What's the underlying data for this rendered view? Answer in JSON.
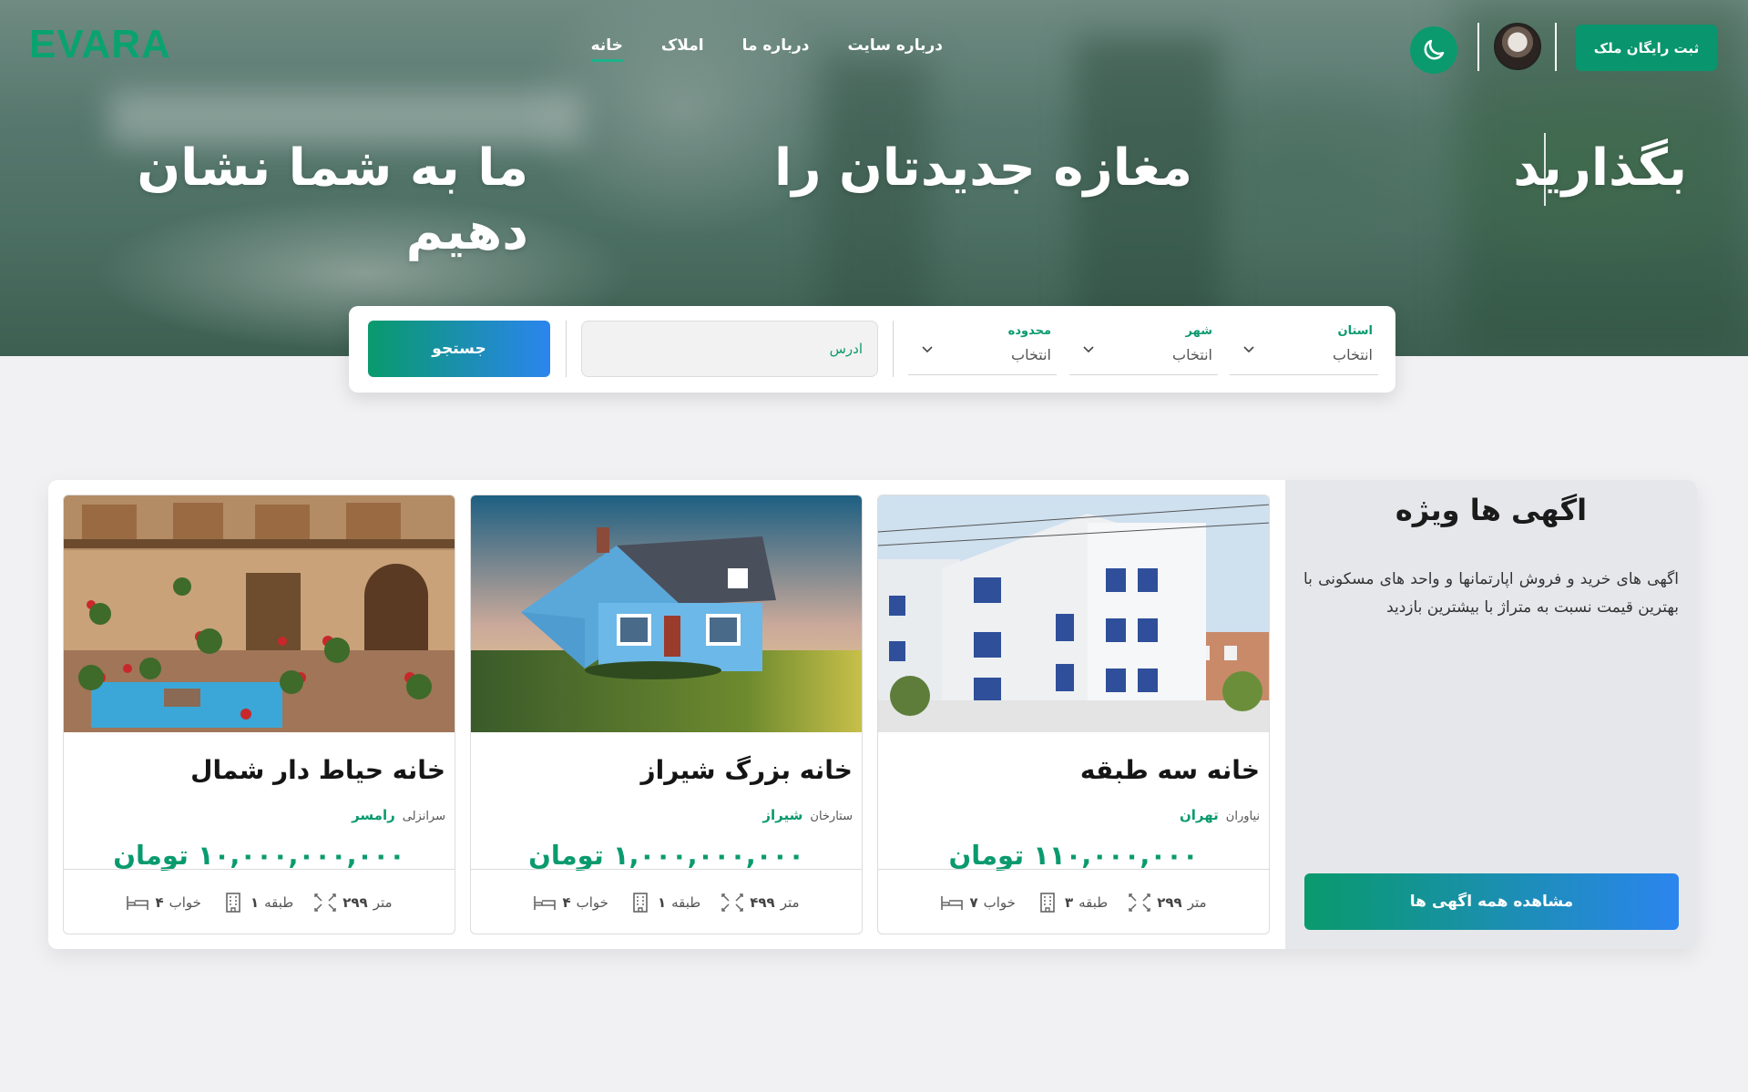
{
  "header": {
    "logo": "EVARA",
    "nav": [
      {
        "label": "خانه",
        "active": true
      },
      {
        "label": "املاک",
        "active": false
      },
      {
        "label": "درباره ما",
        "active": false
      },
      {
        "label": "درباره سایت",
        "active": false
      }
    ],
    "register_button": "ثبت رایگان ملک",
    "theme_icon": "moon-icon",
    "accent_color": "#09956d"
  },
  "hero": {
    "text_right": "بگذارید",
    "text_middle": "مغازه جدیدتان را",
    "text_left": "ما به شما نشان دهیم"
  },
  "search": {
    "province": {
      "label": "استان",
      "value": "انتخاب"
    },
    "city": {
      "label": "شهر",
      "value": "انتخاب"
    },
    "district": {
      "label": "محدوده",
      "value": "انتخاب"
    },
    "address_placeholder": "ادرس",
    "button": "جستجو"
  },
  "featured": {
    "title": "اگهی ها ویژه",
    "description": "اگهی های خرید و فروش اپارتمانها و واحد های مسکونی با بهترین قیمت نسبت به متراژ با بیشترین بازدید",
    "button": "مشاهده همه اگهی ها",
    "listings": [
      {
        "title": "خانه سه طبقه",
        "city": "تهران",
        "area": "نیاوران",
        "price": "۱۱۰,۰۰۰,۰۰۰ تومان",
        "bedrooms": "۷",
        "bedrooms_label": "خواب",
        "floors": "۳",
        "floors_label": "طبقه",
        "size": "۲۹۹",
        "size_label": "متر"
      },
      {
        "title": "خانه بزرگ شیراز",
        "city": "شیراز",
        "area": "ستارخان",
        "price": "۱,۰۰۰,۰۰۰,۰۰۰ تومان",
        "bedrooms": "۴",
        "bedrooms_label": "خواب",
        "floors": "۱",
        "floors_label": "طبقه",
        "size": "۴۹۹",
        "size_label": "متر"
      },
      {
        "title": "خانه حیاط دار شمال",
        "city": "رامسر",
        "area": "سرانزلی",
        "price": "۱۰,۰۰۰,۰۰۰,۰۰۰ تومان",
        "bedrooms": "۴",
        "bedrooms_label": "خواب",
        "floors": "۱",
        "floors_label": "طبقه",
        "size": "۲۹۹",
        "size_label": "متر"
      }
    ]
  }
}
